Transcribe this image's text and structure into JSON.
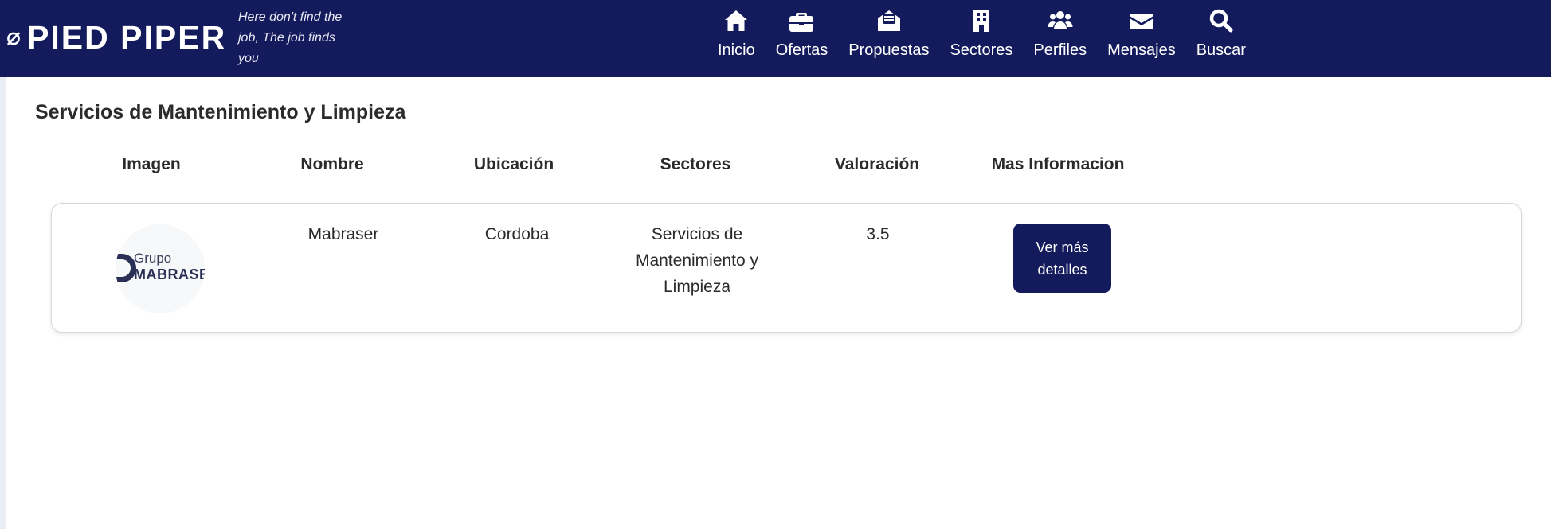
{
  "header": {
    "brand_mark": "⌀",
    "brand_name": "PIED PIPER",
    "tagline": "Here don't find the job, The job finds you",
    "nav": [
      {
        "label": "Inicio",
        "icon": "home-icon"
      },
      {
        "label": "Ofertas",
        "icon": "briefcase-icon"
      },
      {
        "label": "Propuestas",
        "icon": "envelope-open-icon"
      },
      {
        "label": "Sectores",
        "icon": "building-icon"
      },
      {
        "label": "Perfiles",
        "icon": "users-icon"
      },
      {
        "label": "Mensajes",
        "icon": "envelope-icon"
      },
      {
        "label": "Buscar",
        "icon": "search-icon"
      }
    ]
  },
  "main": {
    "title": "Servicios de Mantenimiento y Limpieza",
    "columns": [
      "Imagen",
      "Nombre",
      "Ubicación",
      "Sectores",
      "Valoración",
      "Mas Informacion"
    ],
    "rows": [
      {
        "logo_text_top": "Grupo",
        "logo_text_bottom": "MABRASER",
        "name": "Mabraser",
        "location": "Cordoba",
        "sector": "Servicios de Mantenimiento y Limpieza",
        "rating": "3.5",
        "button_label": "Ver más detalles"
      }
    ]
  },
  "colors": {
    "navbar": "#131b5c",
    "button": "#131b5c",
    "text": "#2b2b2b"
  }
}
